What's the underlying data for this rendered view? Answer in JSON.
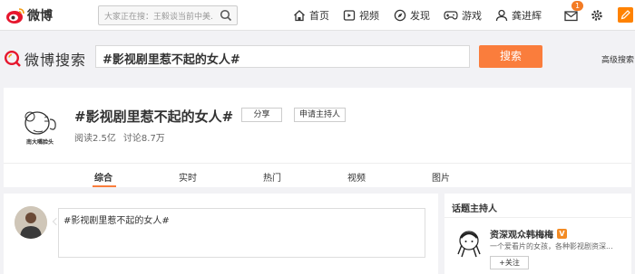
{
  "topbar": {
    "logo_text": "微博",
    "search_placeholder": "大家正在搜：王毅谈当前中美...",
    "nav": [
      {
        "label": "首页",
        "icon": "home-icon"
      },
      {
        "label": "视频",
        "icon": "video-icon"
      },
      {
        "label": "发现",
        "icon": "compass-icon"
      },
      {
        "label": "游戏",
        "icon": "gamepad-icon"
      },
      {
        "label": "龚进辉",
        "icon": "user-icon"
      }
    ],
    "message_count": "1",
    "colors": {
      "accent": "#ff8200",
      "logo_red": "#e6162d"
    }
  },
  "search": {
    "logo_text": "微博搜索",
    "query": "#影视剧里惹不起的女人#",
    "button_label": "搜索",
    "advanced_label": "高级搜索",
    "button_color": "#fa7d3c"
  },
  "topic": {
    "title": "#影视剧里惹不起的女人#",
    "avatar_caption": "南大嘴脸头",
    "share_label": "分享",
    "apply_host_label": "申请主持人",
    "reads": "阅读2.5亿",
    "discussions": "讨论8.7万"
  },
  "tabs": [
    {
      "label": "综合",
      "active": true
    },
    {
      "label": "实时",
      "active": false
    },
    {
      "label": "热门",
      "active": false
    },
    {
      "label": "视频",
      "active": false
    },
    {
      "label": "图片",
      "active": false
    }
  ],
  "compose": {
    "text": "#影视剧里惹不起的女人#"
  },
  "host_panel": {
    "title": "话题主持人",
    "host_name": "资深观众韩梅梅",
    "verified_badge": "V",
    "description": "一个爱看片的女孩，各种影视剧资深...",
    "follow_label": "+关注"
  }
}
